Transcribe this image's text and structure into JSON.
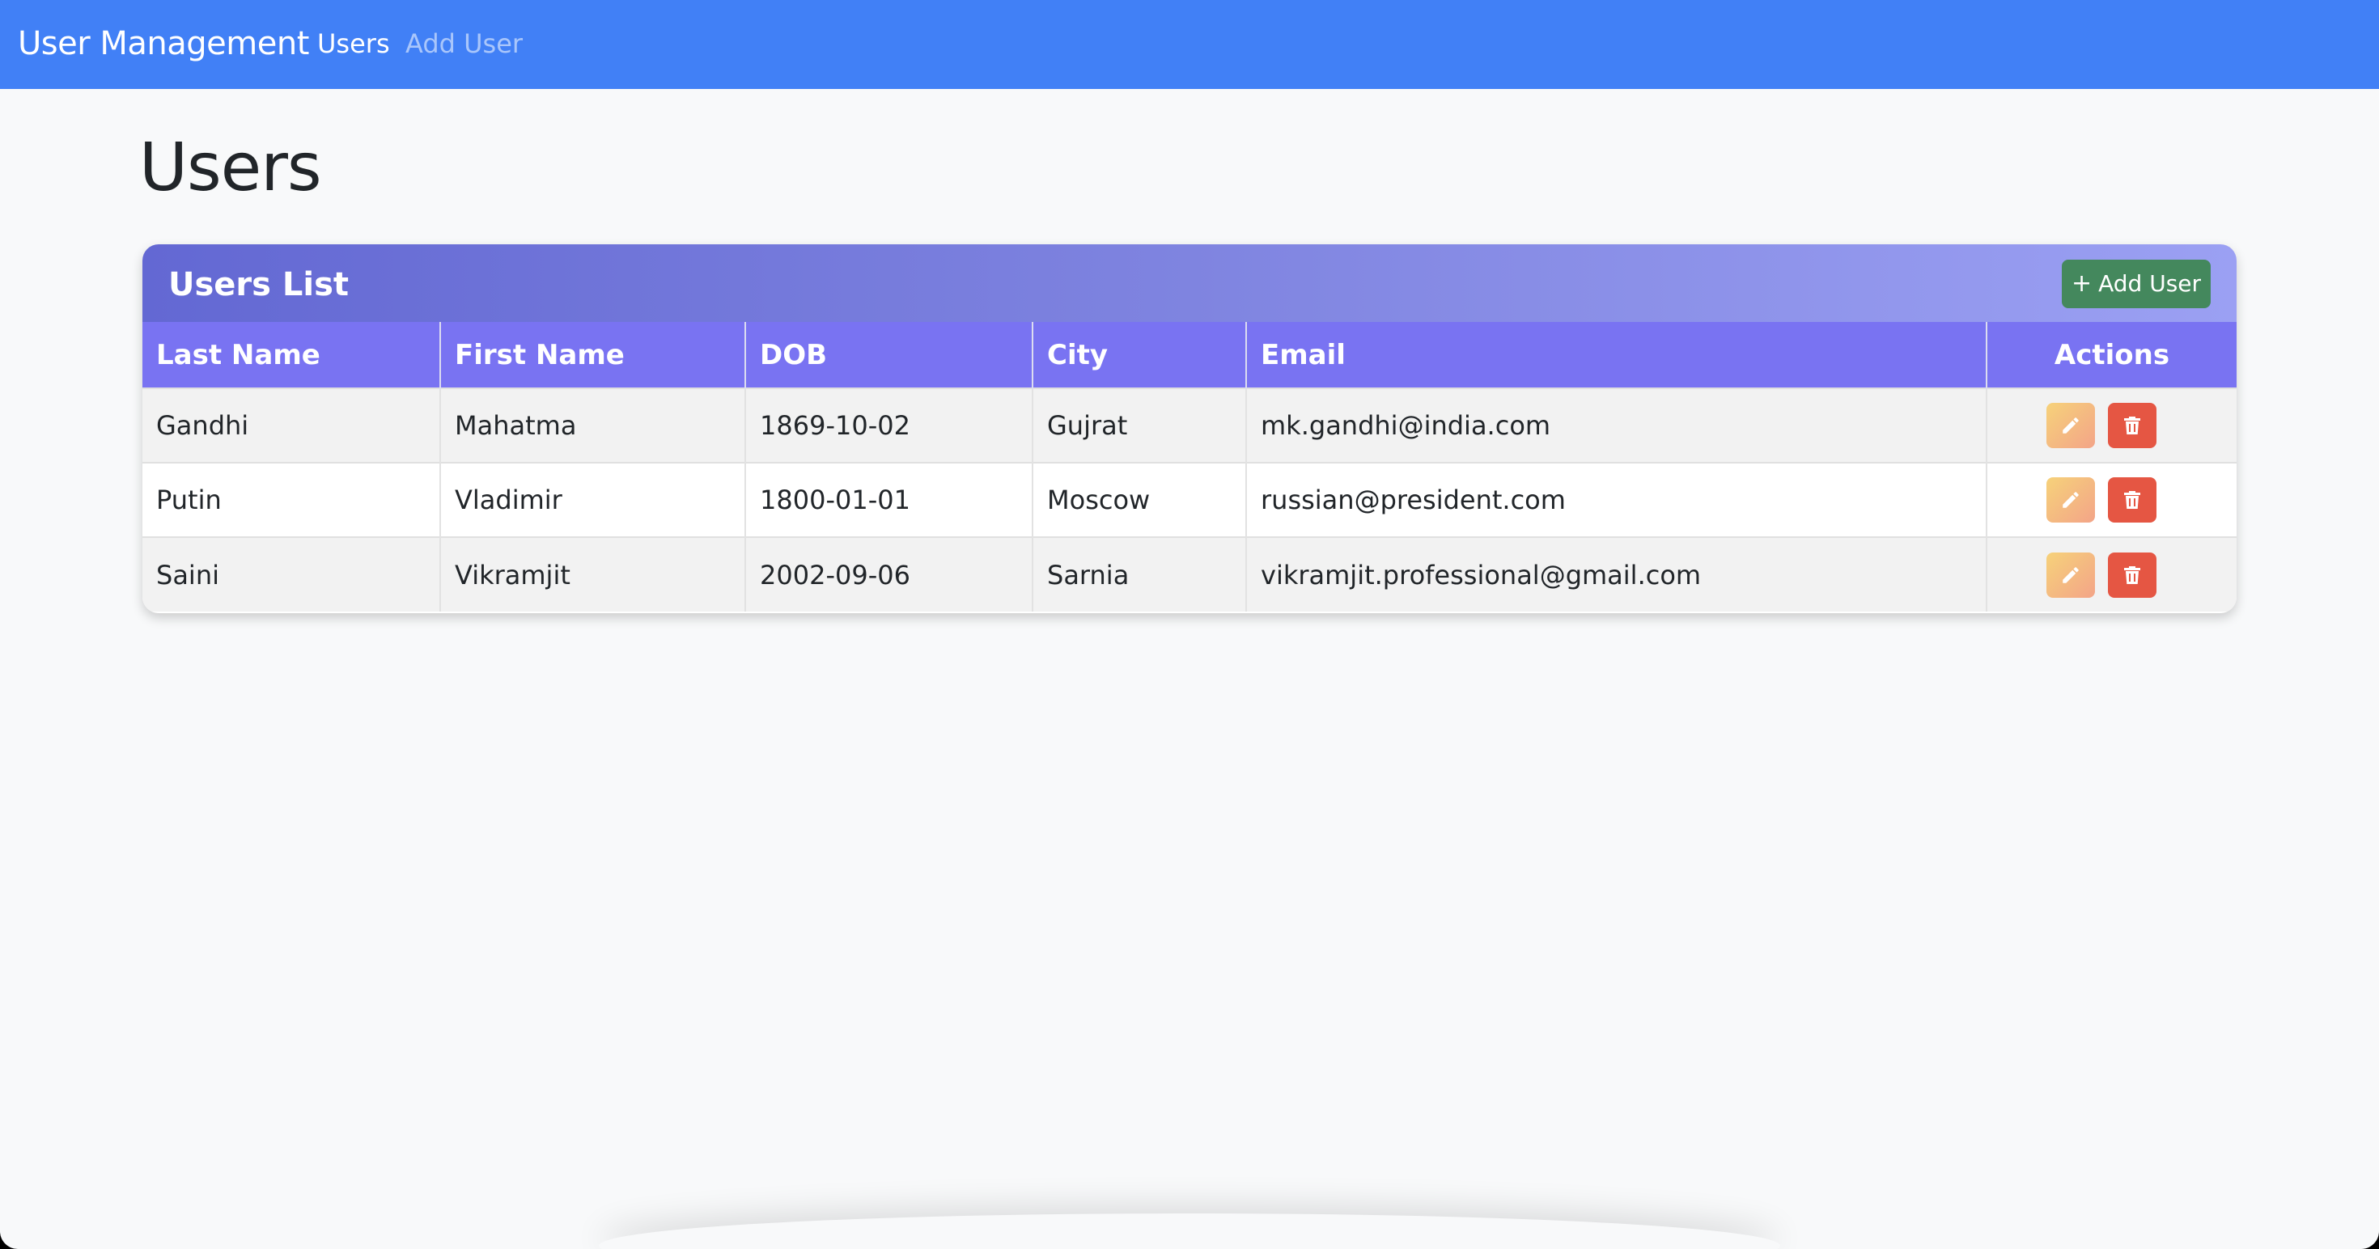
{
  "navbar": {
    "brand": "User Management",
    "links": [
      {
        "label": "Users",
        "active": true
      },
      {
        "label": "Add User",
        "active": false
      }
    ],
    "color": "#4180f6"
  },
  "page": {
    "title": "Users"
  },
  "card": {
    "title": "Users List",
    "add_button_label": "Add User",
    "add_button_icon": "plus-icon"
  },
  "table": {
    "columns": [
      "Last Name",
      "First Name",
      "DOB",
      "City",
      "Email",
      "Actions"
    ],
    "rows": [
      {
        "last_name": "Gandhi",
        "first_name": "Mahatma",
        "dob": "1869-10-02",
        "city": "Gujrat",
        "email": "mk.gandhi@india.com"
      },
      {
        "last_name": "Putin",
        "first_name": "Vladimir",
        "dob": "1800-01-01",
        "city": "Moscow",
        "email": "russian@president.com"
      },
      {
        "last_name": "Saini",
        "first_name": "Vikramjit",
        "dob": "2002-09-06",
        "city": "Sarnia",
        "email": "vikramjit.professional@gmail.com"
      }
    ],
    "row_actions": [
      {
        "name": "edit",
        "icon": "pencil-icon",
        "color": "#f6c27e"
      },
      {
        "name": "delete",
        "icon": "trash-icon",
        "color": "#e55643"
      }
    ]
  }
}
